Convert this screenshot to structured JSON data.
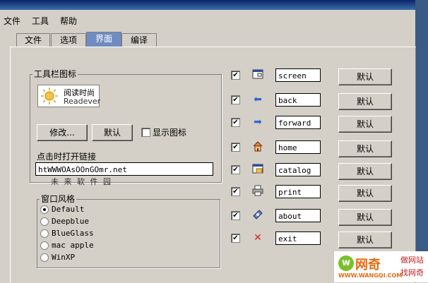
{
  "menu": {
    "items": [
      "文件",
      "工具",
      "帮助"
    ]
  },
  "tabs": [
    "文件",
    "选项",
    "界面",
    "编译"
  ],
  "active_tab": 2,
  "toolbar_group": {
    "title": "工具栏图标",
    "preview_line1": "阅读时尚",
    "preview_line2": "Readever",
    "modify_label": "修改...",
    "default_label": "默认",
    "show_icon_label": "显示图标",
    "link_label": "点击时打开链接",
    "link_value": "htWWWOAsOOnGOmr.net",
    "watermark_text": "未 来 软 件 园"
  },
  "style_group": {
    "title": "窗口风格",
    "options": [
      "Default",
      "Deepblue",
      "BlueGlass",
      "mac apple",
      "WinXP"
    ],
    "selected": 0
  },
  "buttons_list": [
    {
      "value": "screen",
      "icon": "screen-icon",
      "default_label": "默认"
    },
    {
      "value": "back",
      "icon": "back-arrow-icon",
      "default_label": "默认"
    },
    {
      "value": "forward",
      "icon": "forward-arrow-icon",
      "default_label": "默认"
    },
    {
      "value": "home",
      "icon": "home-icon",
      "default_label": "默认"
    },
    {
      "value": "catalog",
      "icon": "catalog-icon",
      "default_label": "默认"
    },
    {
      "value": "print",
      "icon": "printer-icon",
      "default_label": "默认"
    },
    {
      "value": "about",
      "icon": "about-icon",
      "default_label": "默认"
    },
    {
      "value": "exit",
      "icon": "close-icon",
      "default_label": "默认"
    }
  ],
  "watermark": {
    "brand": "网奇",
    "url": "WWW.WANGQI.COM",
    "slogan1": "做网站",
    "slogan2": "找网奇"
  }
}
